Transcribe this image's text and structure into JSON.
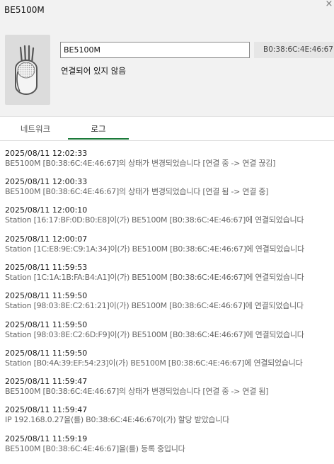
{
  "window": {
    "title": "BE5100M",
    "close_glyph": "×"
  },
  "device": {
    "image_icon": "router-device-icon",
    "name_value": "BE5100M",
    "mac": "B0:38:6C:4E:46:67",
    "status": "연결되어 있지 않음"
  },
  "tabs": [
    {
      "label": "네트워크",
      "selected": false
    },
    {
      "label": "로그",
      "selected": true
    }
  ],
  "accent_color": "#1b7a3a",
  "logs": [
    {
      "time": "2025/08/11 12:02:33",
      "message": "BE5100M [B0:38:6C:4E:46:67]의 상태가 변경되었습니다 [연결 중 -> 연결 끊김]"
    },
    {
      "time": "2025/08/11 12:00:33",
      "message": "BE5100M [B0:38:6C:4E:46:67]의 상태가 변경되었습니다 [연결 됨 -> 연결 중]"
    },
    {
      "time": "2025/08/11 12:00:10",
      "message": "Station [16:17:BF:0D:B0:E8]이(가) BE5100M [B0:38:6C:4E:46:67]에 연결되었습니다"
    },
    {
      "time": "2025/08/11 12:00:07",
      "message": "Station [1C:E8:9E:C9:1A:34]이(가) BE5100M [B0:38:6C:4E:46:67]에 연결되었습니다"
    },
    {
      "time": "2025/08/11 11:59:53",
      "message": "Station [1C:1A:1B:FA:B4:A1]이(가) BE5100M [B0:38:6C:4E:46:67]에 연결되었습니다"
    },
    {
      "time": "2025/08/11 11:59:50",
      "message": "Station [98:03:8E:C2:61:21]이(가) BE5100M [B0:38:6C:4E:46:67]에 연결되었습니다"
    },
    {
      "time": "2025/08/11 11:59:50",
      "message": "Station [98:03:8E:C2:6D:F9]이(가) BE5100M [B0:38:6C:4E:46:67]에 연결되었습니다"
    },
    {
      "time": "2025/08/11 11:59:50",
      "message": "Station [B0:4A:39:EF:54:23]이(가) BE5100M [B0:38:6C:4E:46:67]에 연결되었습니다"
    },
    {
      "time": "2025/08/11 11:59:47",
      "message": "BE5100M [B0:38:6C:4E:46:67]의 상태가 변경되었습니다 [연결 중 -> 연결 됨]"
    },
    {
      "time": "2025/08/11 11:59:47",
      "message": "IP 192.168.0.27을(를) B0:38:6C:4E:46:67이(가) 할당 받았습니다"
    },
    {
      "time": "2025/08/11 11:59:19",
      "message": "BE5100M [B0:38:6C:4E:46:67]을(를) 등록 중입니다"
    }
  ]
}
